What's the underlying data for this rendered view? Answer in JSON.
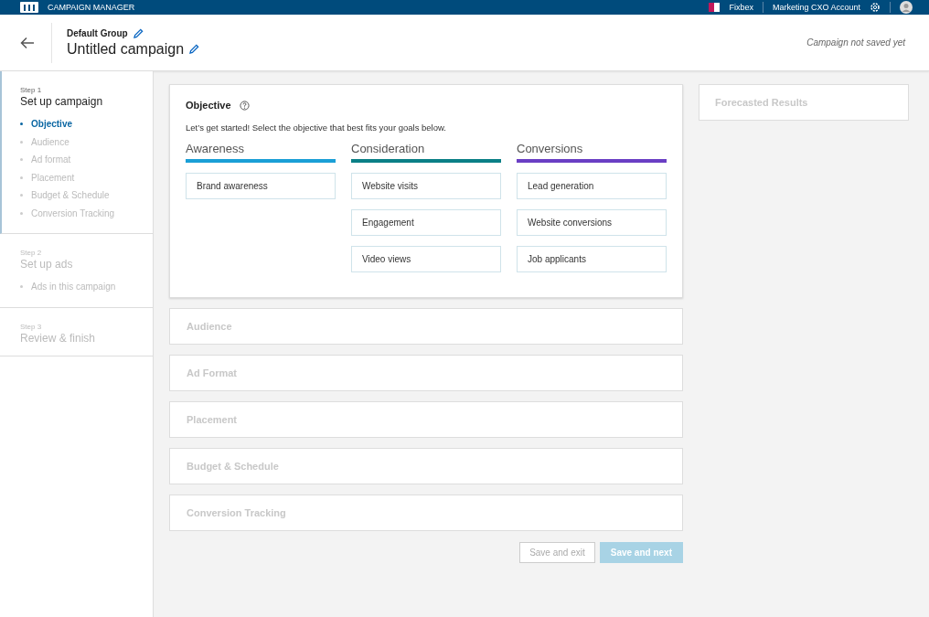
{
  "top_bar": {
    "app_title": "CAMPAIGN MANAGER",
    "company": "Fixbex",
    "account": "Marketing CXO Account"
  },
  "header": {
    "group": "Default Group",
    "campaign": "Untitled campaign",
    "status": "Campaign not saved yet"
  },
  "steps": [
    {
      "step": "Step 1",
      "title": "Set up campaign",
      "active": true,
      "items": [
        {
          "label": "Objective",
          "selected": true
        },
        {
          "label": "Audience",
          "selected": false
        },
        {
          "label": "Ad format",
          "selected": false
        },
        {
          "label": "Placement",
          "selected": false
        },
        {
          "label": "Budget & Schedule",
          "selected": false
        },
        {
          "label": "Conversion Tracking",
          "selected": false
        }
      ]
    },
    {
      "step": "Step 2",
      "title": "Set up ads",
      "active": false,
      "items": [
        {
          "label": "Ads in this campaign",
          "selected": false
        }
      ]
    },
    {
      "step": "Step 3",
      "title": "Review & finish",
      "active": false
    }
  ],
  "objective": {
    "title": "Objective",
    "intro": "Let’s get started! Select the objective that best fits your goals below.",
    "columns": [
      {
        "name": "Awareness",
        "color": "#1a9fd6",
        "options": [
          "Brand awareness"
        ]
      },
      {
        "name": "Consideration",
        "color": "#0a7f86",
        "options": [
          "Website visits",
          "Engagement",
          "Video views"
        ]
      },
      {
        "name": "Conversions",
        "color": "#6a3fc4",
        "options": [
          "Lead generation",
          "Website conversions",
          "Job applicants"
        ]
      }
    ]
  },
  "sections": [
    "Audience",
    "Ad Format",
    "Placement",
    "Budget & Schedule",
    "Conversion Tracking"
  ],
  "buttons": [
    {
      "label": "Save and exit",
      "kind": "secondary",
      "disabled": true
    },
    {
      "label": "Save and next",
      "kind": "primary",
      "disabled": true
    }
  ],
  "forecast": {
    "title": "Forecasted Results"
  }
}
